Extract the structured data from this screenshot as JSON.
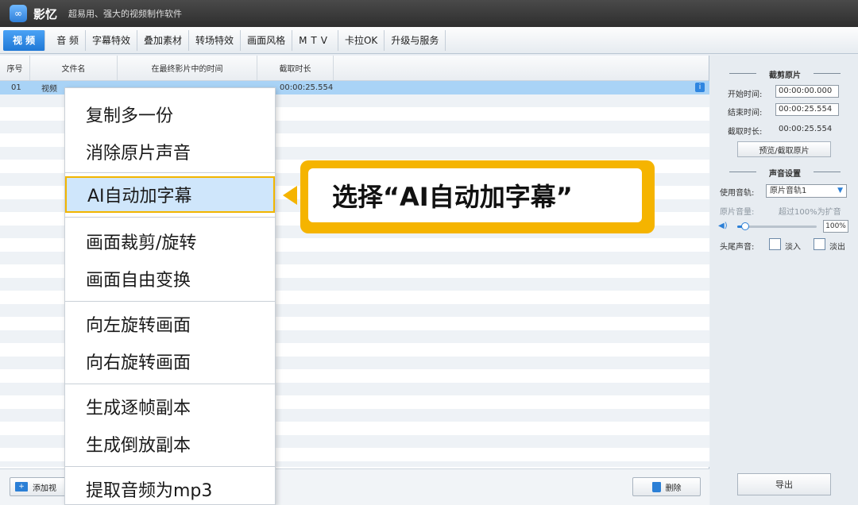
{
  "app": {
    "name": "影忆",
    "slogan": "超易用、强大的视频制作软件",
    "logo_text": "∞"
  },
  "tabs": [
    {
      "label": "视 频",
      "active": true
    },
    {
      "label": "音 频"
    },
    {
      "label": "字幕特效"
    },
    {
      "label": "叠加素材"
    },
    {
      "label": "转场特效"
    },
    {
      "label": "画面风格"
    },
    {
      "label": "MTV"
    },
    {
      "label": "卡拉OK"
    },
    {
      "label": "升级与服务"
    }
  ],
  "table": {
    "headers": [
      "序号",
      "文件名",
      "在最终影片中的时间",
      "截取时长"
    ],
    "selected_row": {
      "index": "01",
      "name": "视频",
      "duration": "00:00:25.554"
    }
  },
  "bottom": {
    "add_label": "添加视",
    "delete_label": "删除"
  },
  "side": {
    "clip_title": "截剪原片",
    "start_label": "开始时间:",
    "start_value": "00:00:00.000",
    "end_label": "结束时间:",
    "end_value": "00:00:25.554",
    "duration_label": "截取时长:",
    "duration_value": "00:00:25.554",
    "preview_button": "预览/截取原片",
    "audio_title": "声音设置",
    "track_label": "使用音轨:",
    "track_value": "原片音轨1",
    "volume_label": "原片音量:",
    "volume_hint": "超过100%为扩音",
    "volume_percent": "100%",
    "volume_fraction": 0.1,
    "fade_label": "头尾声音:",
    "fade_in": "淡入",
    "fade_out": "淡出",
    "export_button": "导出"
  },
  "context_menu": {
    "items": [
      "复制多一份",
      "消除原片声音",
      "AI自动加字幕",
      "画面裁剪/旋转",
      "画面自由变换",
      "向左旋转画面",
      "向右旋转画面",
      "生成逐帧副本",
      "生成倒放副本",
      "提取音频为mp3"
    ]
  },
  "callout": {
    "text": "选择“AI自动加字幕”"
  },
  "colors": {
    "accent": "#1f78d6",
    "highlight": "#f5b400",
    "selected_row": "#a9d3f6"
  }
}
